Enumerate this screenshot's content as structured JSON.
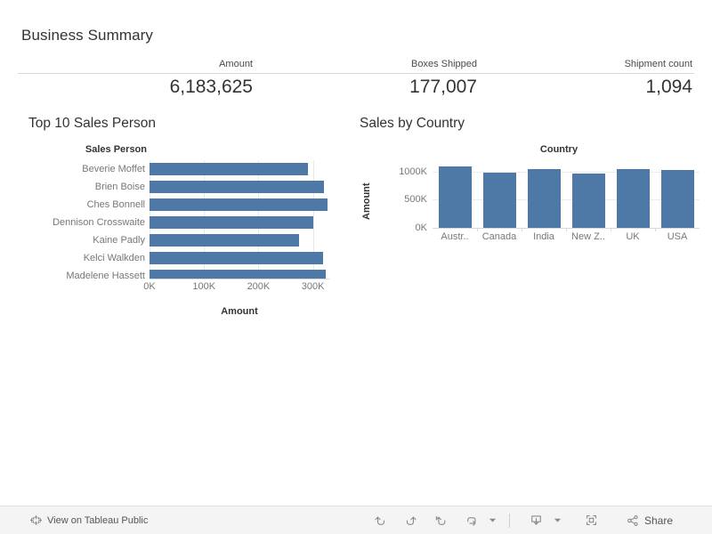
{
  "dashboard": {
    "title": "Business Summary",
    "background": "#ffffff",
    "accent_color": "#4e79a7"
  },
  "kpis": [
    {
      "label": "Amount",
      "value": "6,183,625"
    },
    {
      "label": "Boxes Shipped",
      "value": "177,007"
    },
    {
      "label": "Shipment count",
      "value": "1,094"
    }
  ],
  "sheets": {
    "left": {
      "title": "Top 10 Sales Person"
    },
    "right": {
      "title": "Sales by Country"
    }
  },
  "chart_data": [
    {
      "type": "bar",
      "orientation": "horizontal",
      "title": "Top 10 Sales Person",
      "xlabel": "Amount",
      "ylabel": "Sales Person",
      "field_label": "Sales Person",
      "axis_title": "Amount",
      "categories": [
        "Beverie Moffet",
        "Brien Boise",
        "Ches Bonnell",
        "Dennison Crosswaite",
        "Kaine Padly",
        "Kelci Walkden",
        "Madelene Hassett"
      ],
      "values": [
        290000,
        320000,
        326000,
        300000,
        275000,
        318000,
        323000
      ],
      "xlim": [
        0,
        330000
      ],
      "tick_values": [
        0,
        100000,
        200000,
        300000
      ],
      "tick_labels": [
        "0K",
        "100K",
        "200K",
        "300K"
      ],
      "grid": true,
      "legend": "none",
      "note": "List is scroll-clipped; last visible row is partially cut off",
      "color": "#4e79a7"
    },
    {
      "type": "bar",
      "orientation": "vertical",
      "title": "Sales by Country",
      "xlabel": "Country",
      "ylabel": "Amount",
      "field_label": "Country",
      "axis_title": "Amount",
      "categories": [
        "Austr..",
        "Canada",
        "India",
        "New Z..",
        "UK",
        "USA"
      ],
      "values": [
        1090000,
        975000,
        1040000,
        965000,
        1045000,
        1030000
      ],
      "ylim": [
        0,
        1200000
      ],
      "tick_values": [
        0,
        500000,
        1000000
      ],
      "tick_labels": [
        "0K",
        "500K",
        "1000K"
      ],
      "grid": true,
      "legend": "none",
      "color": "#4e79a7"
    }
  ],
  "toolbar": {
    "tableau_link": "View on Tableau Public",
    "tableau_icon": "tableau-logo-icon",
    "actions": [
      {
        "name": "undo",
        "icon": "undo-icon"
      },
      {
        "name": "redo",
        "icon": "redo-icon"
      },
      {
        "name": "revert",
        "icon": "revert-icon"
      },
      {
        "name": "refresh",
        "icon": "refresh-icon"
      },
      {
        "name": "download",
        "icon": "download-icon"
      },
      {
        "name": "fullscreen",
        "icon": "fullscreen-icon"
      }
    ],
    "share_label": "Share",
    "share_icon": "share-nodes-icon"
  }
}
